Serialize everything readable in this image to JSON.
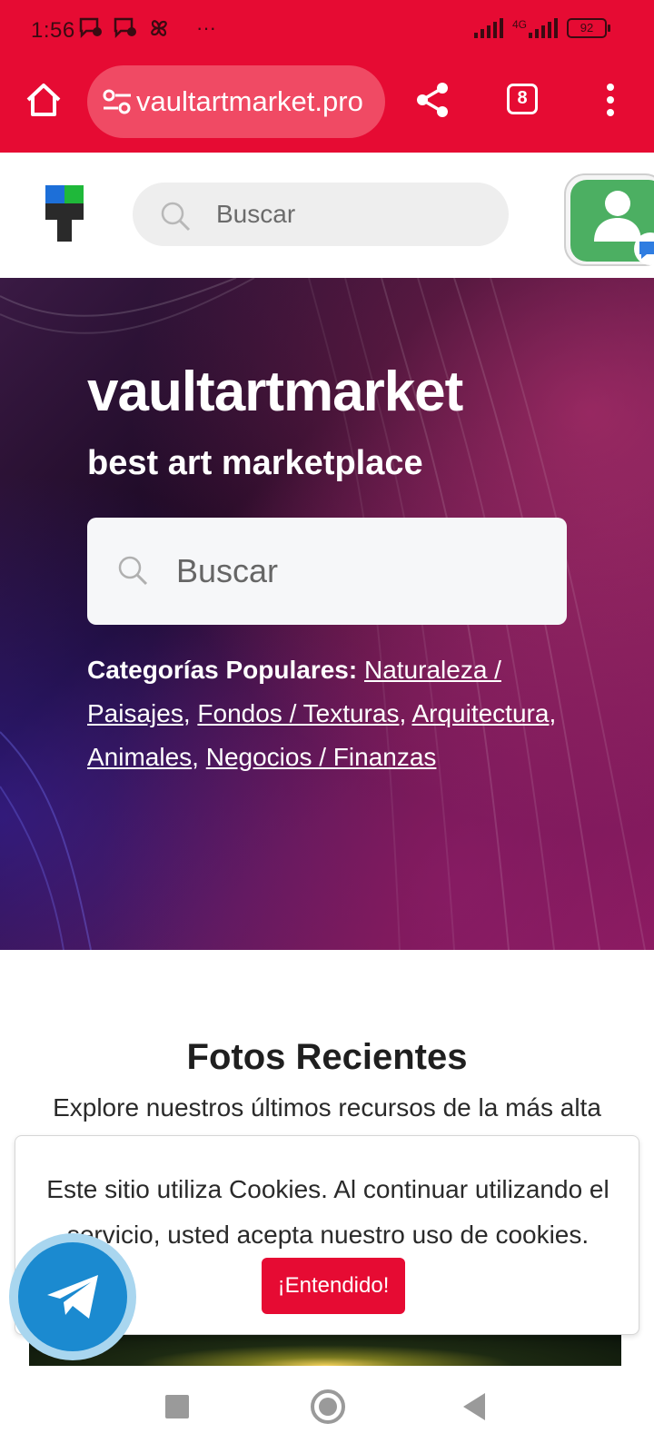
{
  "status_bar": {
    "time": "1:56",
    "overflow": "···",
    "network": "4G",
    "battery": "92"
  },
  "browser": {
    "url": "vaultartmarket.pro",
    "tab_count": "8",
    "accent_color": "#e60b33"
  },
  "site_header": {
    "search_placeholder": "Buscar"
  },
  "hero": {
    "title": "vaultartmarket",
    "subtitle": "best art marketplace",
    "search_placeholder": "Buscar",
    "categories_label": "Categorías Populares:",
    "categories": [
      "Naturaleza / Paisajes",
      "Fondos / Texturas",
      "Arquitectura",
      "Animales",
      "Negocios / Finanzas"
    ]
  },
  "recent": {
    "title": "Fotos Recientes",
    "description": "Explore nuestros últimos recursos de la más alta"
  },
  "cookie_banner": {
    "text": "Este sitio utiliza Cookies. Al continuar utilizando el servicio, usted acepta nuestro uso de cookies.",
    "button_label": "¡Entendido!"
  },
  "icons": {
    "home": "home-icon",
    "site_settings": "tune-icon",
    "share": "share-icon",
    "tabs": "tabs-icon",
    "menu": "more-vertical-icon",
    "search": "search-icon",
    "telegram": "telegram-icon"
  }
}
